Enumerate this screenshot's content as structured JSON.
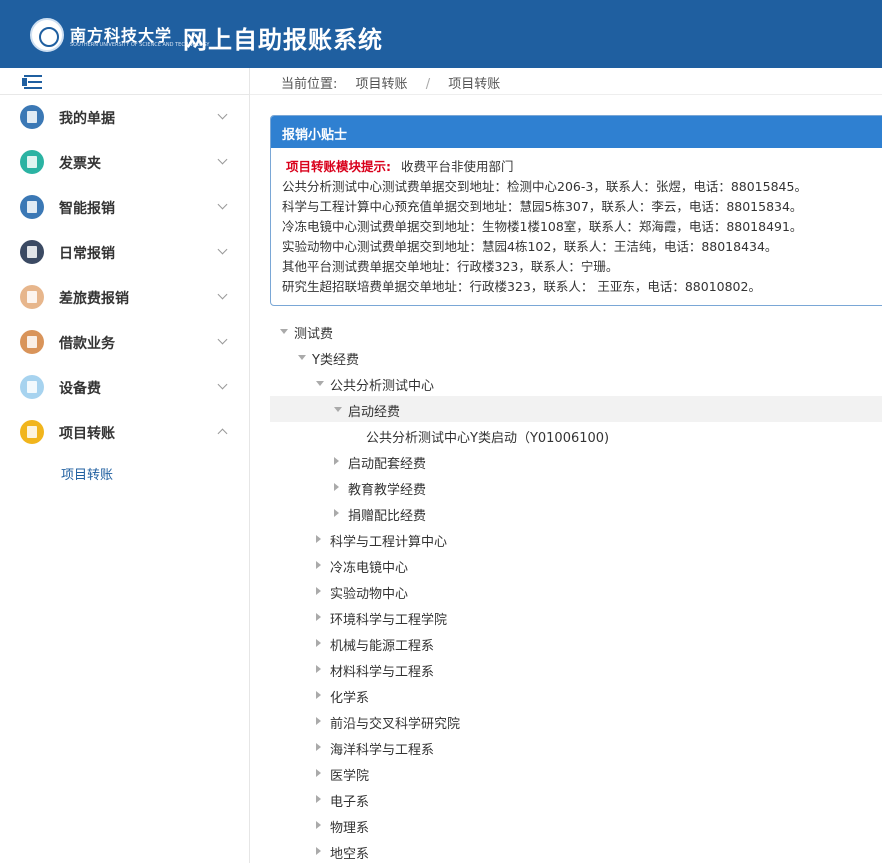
{
  "header": {
    "logo_cn": "南方科技大学",
    "logo_en": "SOUTHERN UNIVERSITY OF SCIENCE AND TECHNOLOGY",
    "system_title": "网上自助报账系统",
    "bg_color": "#1f5fa0"
  },
  "sidebar": {
    "collapse_icon": "menu-collapse-icon",
    "items": [
      {
        "label": "我的单据",
        "icon": "document-icon",
        "color": "#3b78b5",
        "expanded": false
      },
      {
        "label": "发票夹",
        "icon": "invoice-icon",
        "color": "#2bb3a3",
        "expanded": false
      },
      {
        "label": "智能报销",
        "icon": "smart-reimburse-icon",
        "color": "#3b78b5",
        "expanded": false
      },
      {
        "label": "日常报销",
        "icon": "cash-icon",
        "color": "#3b4a63",
        "expanded": false
      },
      {
        "label": "差旅费报销",
        "icon": "car-icon",
        "color": "#e7b68c",
        "expanded": false
      },
      {
        "label": "借款业务",
        "icon": "loan-icon",
        "color": "#d9945a",
        "expanded": false
      },
      {
        "label": "设备费",
        "icon": "equipment-icon",
        "color": "#a7d3ef",
        "expanded": false
      },
      {
        "label": "项目转账",
        "icon": "project-transfer-icon",
        "color": "#f1b51c",
        "expanded": true
      }
    ],
    "submenu": [
      {
        "label": "项目转账"
      }
    ]
  },
  "breadcrumb": {
    "prefix": "当前位置:",
    "items": [
      "项目转账",
      "/",
      "项目转账"
    ]
  },
  "tips": {
    "title": "报销小贴士",
    "highlight": "项目转账模块提示:",
    "first_line_rest": "收费平台非使用部门",
    "lines": [
      "公共分析测试中心测试费单据交到地址：检测中心206-3，联系人：张煜，电话：88015845。",
      "科学与工程计算中心预充值单据交到地址：慧园5栋307，联系人：李云，电话：88015834。",
      "冷冻电镜中心测试费单据交到地址：生物楼1楼108室，联系人：郑海霞，电话：88018491。",
      "实验动物中心测试费单据交到地址：慧园4栋102，联系人：王洁纯，电话：88018434。",
      "其他平台测试费单据交单地址：行政楼323，联系人：宁珊。",
      "研究生超招联培费单据交单地址：行政楼323，联系人： 王亚东，电话：88010802。"
    ]
  },
  "tree": [
    {
      "label": "测试费",
      "level": 0,
      "state": "open"
    },
    {
      "label": "Y类经费",
      "level": 1,
      "state": "open"
    },
    {
      "label": "公共分析测试中心",
      "level": 2,
      "state": "open"
    },
    {
      "label": "启动经费",
      "level": 3,
      "state": "open",
      "selected": true
    },
    {
      "label": "公共分析测试中心Y类启动（Y01006100)",
      "level": 4,
      "state": "leaf"
    },
    {
      "label": "启动配套经费",
      "level": 3,
      "state": "closed"
    },
    {
      "label": "教育教学经费",
      "level": 3,
      "state": "closed"
    },
    {
      "label": "捐赠配比经费",
      "level": 3,
      "state": "closed"
    },
    {
      "label": "科学与工程计算中心",
      "level": 2,
      "state": "closed"
    },
    {
      "label": "冷冻电镜中心",
      "level": 2,
      "state": "closed"
    },
    {
      "label": "实验动物中心",
      "level": 2,
      "state": "closed"
    },
    {
      "label": "环境科学与工程学院",
      "level": 2,
      "state": "closed"
    },
    {
      "label": "机械与能源工程系",
      "level": 2,
      "state": "closed"
    },
    {
      "label": "材料科学与工程系",
      "level": 2,
      "state": "closed"
    },
    {
      "label": "化学系",
      "level": 2,
      "state": "closed"
    },
    {
      "label": "前沿与交叉科学研究院",
      "level": 2,
      "state": "closed"
    },
    {
      "label": "海洋科学与工程系",
      "level": 2,
      "state": "closed"
    },
    {
      "label": "医学院",
      "level": 2,
      "state": "closed"
    },
    {
      "label": "电子系",
      "level": 2,
      "state": "closed"
    },
    {
      "label": "物理系",
      "level": 2,
      "state": "closed"
    },
    {
      "label": "地空系",
      "level": 2,
      "state": "closed"
    }
  ]
}
